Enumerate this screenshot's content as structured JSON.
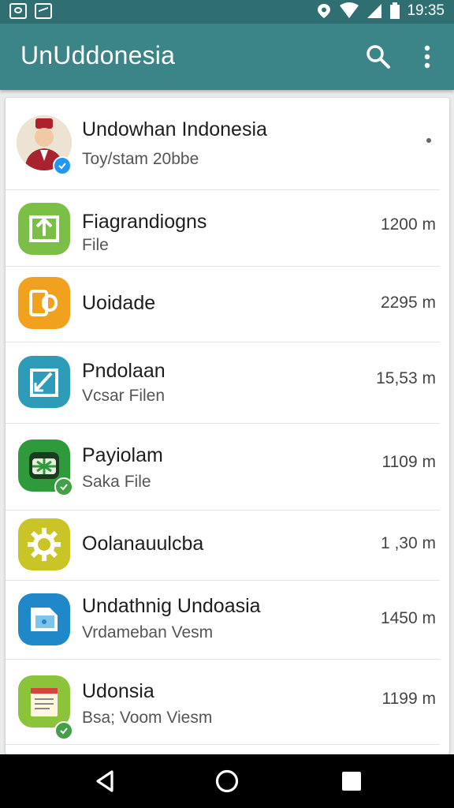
{
  "status_bar": {
    "time": "19:35"
  },
  "app_bar": {
    "title": "UnUddonesia"
  },
  "profile": {
    "name": "Undowhan Indonesia",
    "subtitle": "Toy/stam 20bbe"
  },
  "items": [
    {
      "title": "Fiagrandiogns",
      "subtitle": "File",
      "size": "1200 m",
      "icon": "upload-icon",
      "color": "#7bbf47",
      "badge": false
    },
    {
      "title": "Uoidade",
      "subtitle": "",
      "size": "2295 m",
      "icon": "document-icon",
      "color": "#f0a21f",
      "badge": false
    },
    {
      "title": "Pndolaan",
      "subtitle": "Vcsar Filen",
      "size": "15,53 m",
      "icon": "edit-icon",
      "color": "#2e9bb8",
      "badge": false
    },
    {
      "title": "Payiolam",
      "subtitle": "Saka File",
      "size": "1109 m",
      "icon": "box-icon",
      "color": "#2f9a3c",
      "badge": true
    },
    {
      "title": "Oolanauulcba",
      "subtitle": "",
      "size": "1 ,30 m",
      "icon": "gear-icon",
      "color": "#c9c526",
      "badge": false
    },
    {
      "title": "Undathnig Undoasia",
      "subtitle": "Vrdameban Vesm",
      "size": "1450 m",
      "icon": "file-icon",
      "color": "#1e88c9",
      "badge": false
    },
    {
      "title": "Udonsia",
      "subtitle": "Bsa; Voom Viesm",
      "size": "1199 m",
      "icon": "notepad-icon",
      "color": "#8bc43a",
      "badge": true
    }
  ]
}
